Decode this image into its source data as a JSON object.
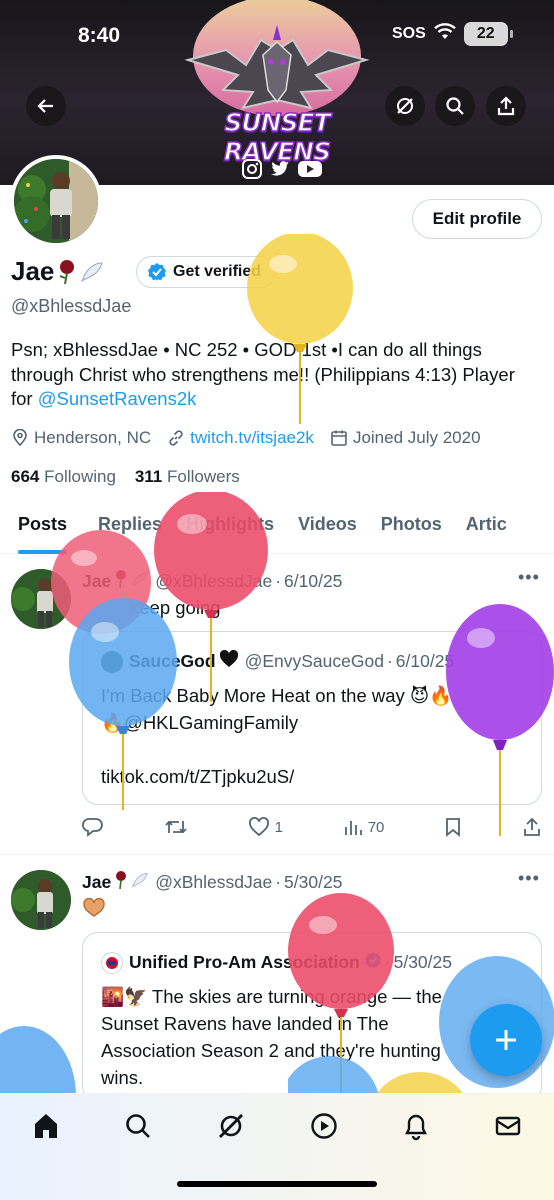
{
  "status_bar": {
    "time": "8:40",
    "sos": "SOS",
    "battery": "22"
  },
  "banner": {
    "logo_text": "SUNSET RAVENS"
  },
  "profile": {
    "name": "Jae",
    "get_verified": "Get verified",
    "handle": "@xBhlessdJae",
    "edit_profile": "Edit profile",
    "bio_text": "Psn; xBhlessdJae • NC 252 • GOD 1st •I can do all things through Christ who strengthens me!! (Philippians 4:13) Player for ",
    "bio_link": "@SunsetRavens2k",
    "location": "Henderson, NC",
    "website": "twitch.tv/itsjae2k",
    "joined": "Joined July 2020",
    "following_count": "664",
    "following_label": "Following",
    "followers_count": "311",
    "followers_label": "Followers"
  },
  "tabs": [
    "Posts",
    "Replies",
    "Highlights",
    "Videos",
    "Photos",
    "Artic"
  ],
  "posts": [
    {
      "name": "Jae",
      "handle": "@xBhlessdJae",
      "date": "6/10/25",
      "text": "keep going",
      "quote": {
        "name": "SauceGod",
        "handle": "@EnvySauceGod",
        "date": "6/10/25",
        "line1": "I'm Back Baby More Heat on the way",
        "line2": "@HKLGamingFamily",
        "line3": "tiktok.com/t/ZTjpku2uS/"
      },
      "likes": "1",
      "views": "70"
    },
    {
      "name": "Jae",
      "handle": "@xBhlessdJae",
      "date": "5/30/25",
      "quote": {
        "name": "Unified Pro-Am Association",
        "date": "5/30/25",
        "line1": "The skies are turning orange — the",
        "line2": "Sunset Ravens have landed in The",
        "line3": "Association Season 2 and they're hunting",
        "line4": "wins."
      }
    }
  ],
  "colors": {
    "accent": "#1d9bf0",
    "text": "#0f1419",
    "muted": "#536471"
  }
}
